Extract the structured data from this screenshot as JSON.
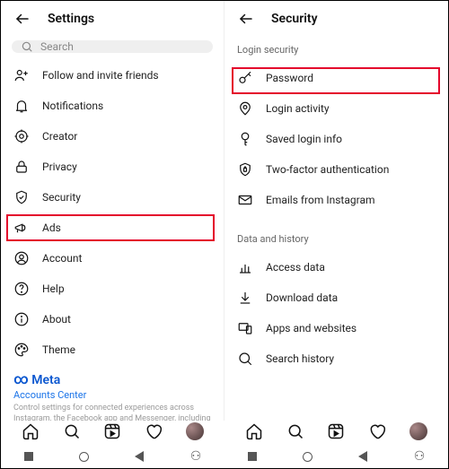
{
  "left": {
    "title": "Settings",
    "search_placeholder": "Search",
    "items": [
      {
        "label": "Follow and invite friends"
      },
      {
        "label": "Notifications"
      },
      {
        "label": "Creator"
      },
      {
        "label": "Privacy"
      },
      {
        "label": "Security"
      },
      {
        "label": "Ads"
      },
      {
        "label": "Account"
      },
      {
        "label": "Help"
      },
      {
        "label": "About"
      },
      {
        "label": "Theme"
      }
    ],
    "meta_logo": "Meta",
    "accounts_center": "Accounts Center",
    "meta_desc": "Control settings for connected experiences across Instagram, the Facebook app and Messenger, including story and post sharing and"
  },
  "right": {
    "title": "Security",
    "section1": "Login security",
    "items1": [
      {
        "label": "Password"
      },
      {
        "label": "Login activity"
      },
      {
        "label": "Saved login info"
      },
      {
        "label": "Two-factor authentication"
      },
      {
        "label": "Emails from Instagram"
      }
    ],
    "section2": "Data and history",
    "items2": [
      {
        "label": "Access data"
      },
      {
        "label": "Download data"
      },
      {
        "label": "Apps and websites"
      },
      {
        "label": "Search history"
      }
    ]
  }
}
